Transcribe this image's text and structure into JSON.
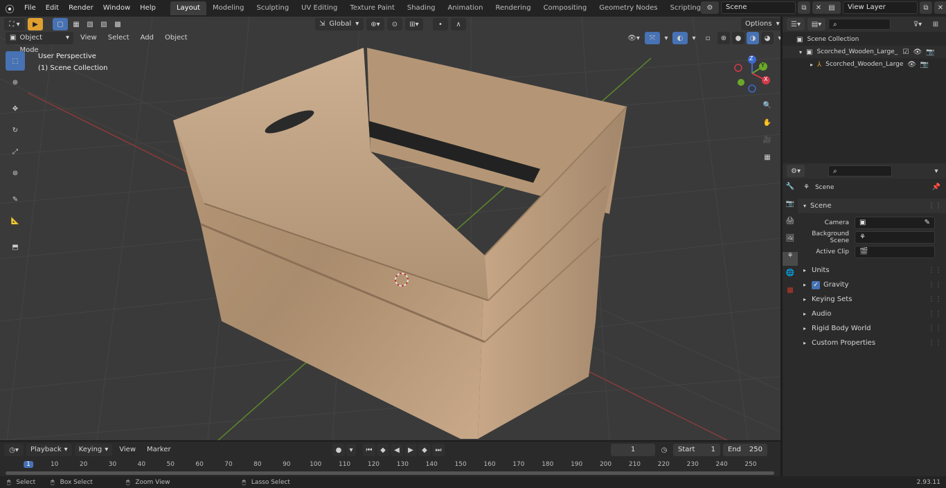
{
  "menus": [
    "File",
    "Edit",
    "Render",
    "Window",
    "Help"
  ],
  "workspaces": [
    "Layout",
    "Modeling",
    "Sculpting",
    "UV Editing",
    "Texture Paint",
    "Shading",
    "Animation",
    "Rendering",
    "Compositing",
    "Geometry Nodes",
    "Scripting"
  ],
  "active_workspace": "Layout",
  "scene_field": "Scene",
  "view_layer_field": "View Layer",
  "viewport": {
    "mode": "Object Mode",
    "header_menus": [
      "View",
      "Select",
      "Add",
      "Object"
    ],
    "orientation": "Global",
    "options_label": "Options",
    "overlay_title": "User Perspective",
    "overlay_collection": "(1) Scene Collection",
    "gizmo_axes": [
      "Z",
      "Y",
      "X"
    ]
  },
  "outliner": {
    "root": "Scene Collection",
    "items": [
      "Scorched_Wooden_Large_Hig",
      "Scorched_Wooden_Large"
    ]
  },
  "properties": {
    "context_label": "Scene",
    "section": "Scene",
    "fields": [
      {
        "label": "Camera",
        "value": ""
      },
      {
        "label": "Background Scene",
        "value": ""
      },
      {
        "label": "Active Clip",
        "value": ""
      }
    ],
    "panels": [
      "Units",
      "Gravity",
      "Keying Sets",
      "Audio",
      "Rigid Body World",
      "Custom Properties"
    ],
    "gravity_checked": true
  },
  "timeline": {
    "menus": [
      "Playback",
      "Keying",
      "View",
      "Marker"
    ],
    "current_frame": "1",
    "start_label": "Start",
    "start_value": "1",
    "end_label": "End",
    "end_value": "250",
    "ticks": [
      "1",
      "10",
      "20",
      "30",
      "40",
      "50",
      "60",
      "70",
      "80",
      "90",
      "100",
      "110",
      "120",
      "130",
      "140",
      "150",
      "160",
      "170",
      "180",
      "190",
      "200",
      "210",
      "220",
      "230",
      "240",
      "250"
    ]
  },
  "statusbar": {
    "select": "Select",
    "box_select": "Box Select",
    "zoom_view": "Zoom View",
    "lasso_select": "Lasso Select",
    "version": "2.93.11"
  }
}
